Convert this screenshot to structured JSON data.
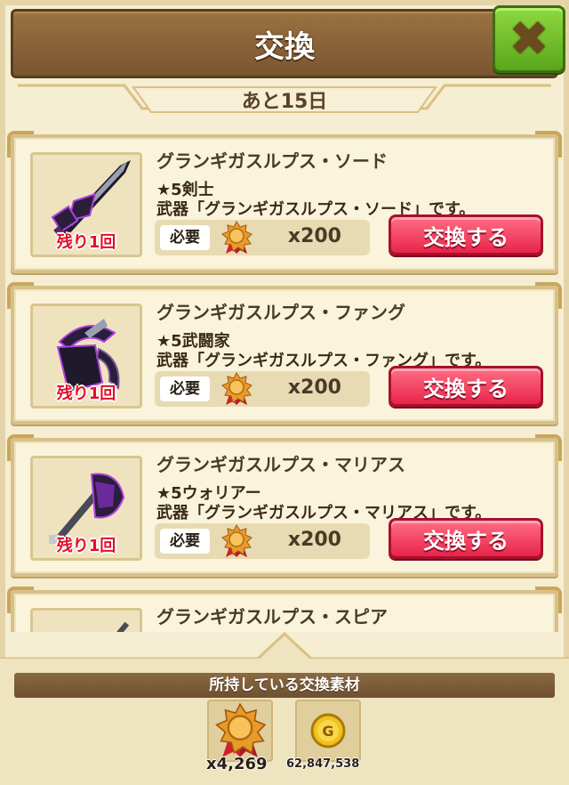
{
  "header": {
    "title": "交換",
    "close_icon": "close-x-icon"
  },
  "period": {
    "days_left": "あと15日"
  },
  "items": [
    {
      "name": "グランギガスルプス・ソード",
      "class_label": "★5剣士",
      "description": "武器「グランギガスルプス・ソード」です。",
      "remaining": "残り1回",
      "required_label": "必要",
      "cost": "x200",
      "button_label": "交換する"
    },
    {
      "name": "グランギガスルプス・ファング",
      "class_label": "★5武闘家",
      "description": "武器「グランギガスルプス・ファング」です。",
      "remaining": "残り1回",
      "required_label": "必要",
      "cost": "x200",
      "button_label": "交換する"
    },
    {
      "name": "グランギガスルプス・マリアス",
      "class_label": "★5ウォリアー",
      "description": "武器「グランギガスルプス・マリアス」です。",
      "remaining": "残り1回",
      "required_label": "必要",
      "cost": "x200",
      "button_label": "交換する"
    },
    {
      "name": "グランギガスルプス・スピア"
    }
  ],
  "owned": {
    "header": "所持している交換素材",
    "medal_count": "x4,269",
    "gold_count": "62,847,538",
    "gold_symbol": "G"
  },
  "colors": {
    "accent_red": "#e8244a",
    "close_green": "#5aa61c",
    "header_brown": "#7a5530"
  }
}
